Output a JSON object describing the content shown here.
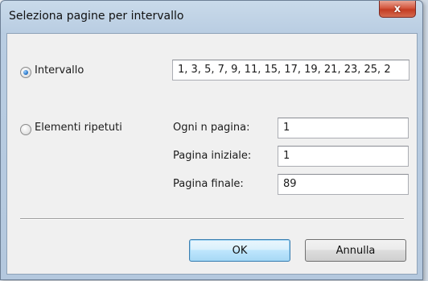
{
  "window": {
    "title": "Seleziona pagine per intervallo",
    "close_label": "x"
  },
  "options": {
    "interval_label": "Intervallo",
    "interval_selected": true,
    "interval_value": "1, 3, 5, 7, 9, 11, 15, 17, 19, 21, 23, 25, 2",
    "repeated_label": "Elementi ripetuti",
    "repeated_selected": false
  },
  "fields": {
    "every_n_label": "Ogni n pagina:",
    "every_n_value": "1",
    "start_label": "Pagina iniziale:",
    "start_value": "1",
    "end_label": "Pagina finale:",
    "end_value": "89"
  },
  "buttons": {
    "ok_label": "OK",
    "cancel_label": "Annulla"
  }
}
